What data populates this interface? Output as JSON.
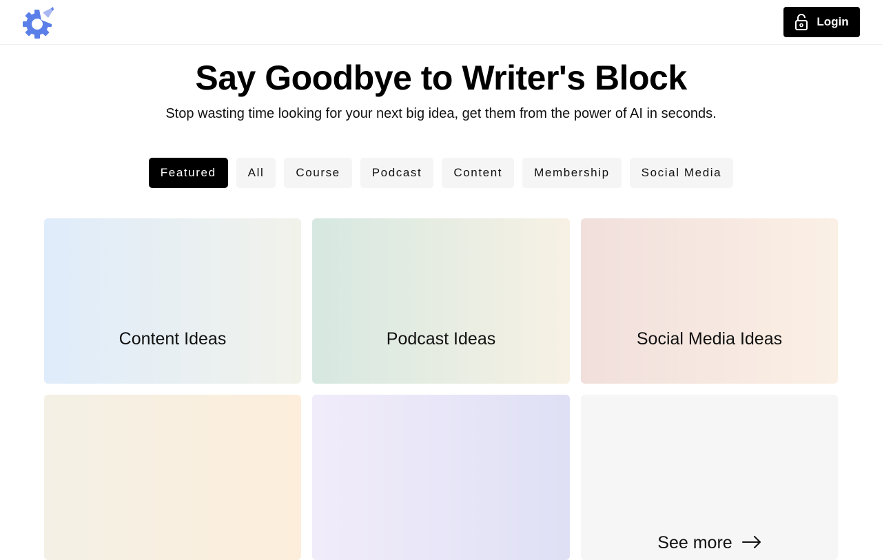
{
  "header": {
    "login_label": "Login"
  },
  "hero": {
    "title": "Say Goodbye to Writer's Block",
    "subtitle": "Stop wasting time looking for your next big idea, get them from the power of AI in seconds."
  },
  "tabs": [
    {
      "label": "Featured",
      "active": true
    },
    {
      "label": "All",
      "active": false
    },
    {
      "label": "Course",
      "active": false
    },
    {
      "label": "Podcast",
      "active": false
    },
    {
      "label": "Content",
      "active": false
    },
    {
      "label": "Membership",
      "active": false
    },
    {
      "label": "Social Media",
      "active": false
    }
  ],
  "cards": [
    {
      "label": "Content Ideas"
    },
    {
      "label": "Podcast Ideas"
    },
    {
      "label": "Social Media Ideas"
    },
    {
      "label": ""
    },
    {
      "label": ""
    },
    {
      "label": "See more"
    }
  ],
  "icons": {
    "logo": "gear-pencil-logo-icon",
    "login": "unlock-icon",
    "see_more": "arrow-right-icon"
  },
  "colors": {
    "brand": "#5b7fe8",
    "primary_button": "#000000"
  }
}
